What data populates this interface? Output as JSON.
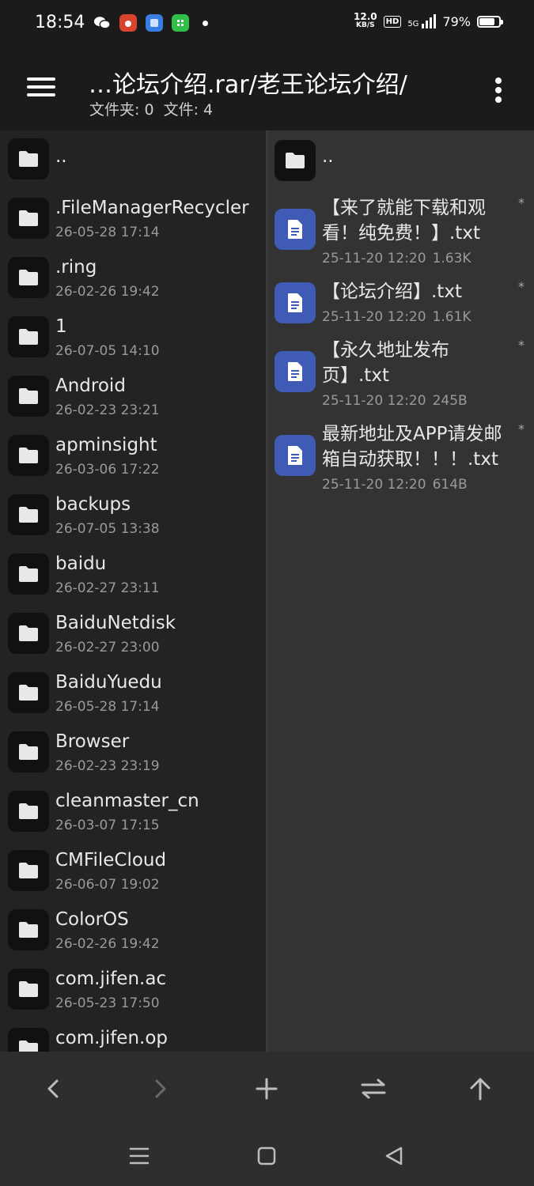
{
  "status_bar": {
    "time": "18:54",
    "net_speed_value": "12.0",
    "net_speed_unit": "KB/S",
    "hd_label": "HD",
    "network_label": "5G",
    "battery": "79%",
    "battery_level": 0.79
  },
  "header": {
    "path": "…论坛介绍.rar/老王论坛介绍/",
    "summary": "文件夹: 0  文件: 4"
  },
  "left_pane": {
    "parent_label": "..",
    "items": [
      {
        "name": ".FileManagerRecycler",
        "date": "26-05-28 17:14"
      },
      {
        "name": ".ring",
        "date": "26-02-26 19:42"
      },
      {
        "name": "1",
        "date": "26-07-05 14:10"
      },
      {
        "name": "Android",
        "date": "26-02-23 23:21"
      },
      {
        "name": "apminsight",
        "date": "26-03-06 17:22"
      },
      {
        "name": "backups",
        "date": "26-07-05 13:38"
      },
      {
        "name": "baidu",
        "date": "26-02-27 23:11"
      },
      {
        "name": "BaiduNetdisk",
        "date": "26-02-27 23:00"
      },
      {
        "name": "BaiduYuedu",
        "date": "26-05-28 17:14"
      },
      {
        "name": "Browser",
        "date": "26-02-23 23:19"
      },
      {
        "name": "cleanmaster_cn",
        "date": "26-03-07 17:15"
      },
      {
        "name": "CMFileCloud",
        "date": "26-06-07 19:02"
      },
      {
        "name": "ColorOS",
        "date": "26-02-26 19:42"
      },
      {
        "name": "com.jifen.ac",
        "date": "26-05-23 17:50"
      },
      {
        "name": "com.jifen.op",
        "date": ""
      }
    ]
  },
  "right_pane": {
    "parent_label": "..",
    "items": [
      {
        "line1": "【来了就能下载和观",
        "line2": "看！纯免费！】.txt",
        "date": "25-11-20 12:20",
        "size": "1.63K",
        "mark": "*"
      },
      {
        "line1": "【论坛介绍】.txt",
        "line2": "",
        "date": "25-11-20 12:20",
        "size": "1.61K",
        "mark": "*"
      },
      {
        "line1": "【永久地址发布",
        "line2": "页】.txt",
        "date": "25-11-20 12:20",
        "size": "245B",
        "mark": "*"
      },
      {
        "line1": "最新地址及APP请发邮",
        "line2": "箱自动获取！！！.txt",
        "date": "25-11-20 12:20",
        "size": "614B",
        "mark": "*"
      }
    ]
  },
  "colors": {
    "background": "#2b2b2b",
    "header": "#1b1b1b",
    "doc_icon": "#3f5bb5"
  }
}
